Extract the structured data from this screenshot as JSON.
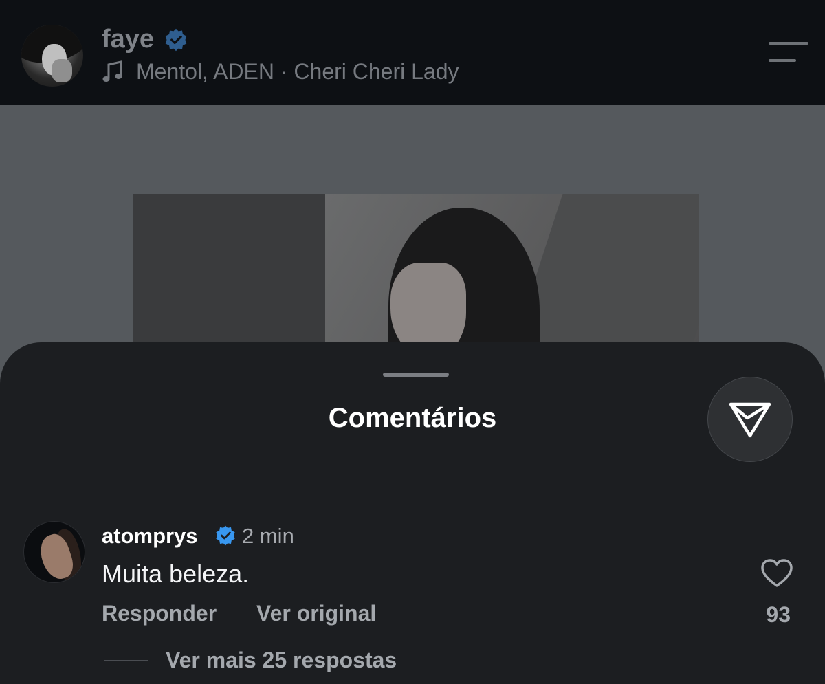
{
  "header": {
    "username": "faye",
    "verified_icon": "verified-badge-icon",
    "music_icon": "music-note-icon",
    "music_text": "Mentol, ADEN · Cheri Cheri Lady",
    "menu_icon": "menu-icon"
  },
  "sheet": {
    "title": "Comentários",
    "share_icon": "send-icon"
  },
  "comment": {
    "username": "atomprys",
    "time": "2 min",
    "text": "Muita beleza.",
    "reply_label": "Responder",
    "see_original_label": "Ver original",
    "like_count": "93",
    "more_replies_label": "Ver mais 25 respostas"
  },
  "colors": {
    "verified": "#3897f0",
    "sheet_bg": "#1c1e21",
    "header_bg": "#0d1014"
  }
}
